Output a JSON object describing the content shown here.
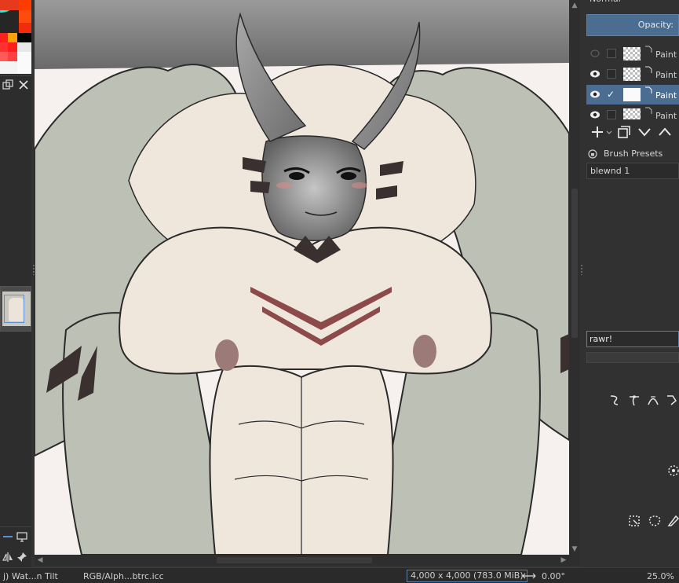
{
  "layers_panel": {
    "blend_mode": "Normal",
    "opacity_label": "Opacity:",
    "layers": [
      {
        "name": "Paint",
        "visible": false,
        "checked": false,
        "selected": false
      },
      {
        "name": "Paint",
        "visible": true,
        "checked": false,
        "selected": false
      },
      {
        "name": "Paint",
        "visible": true,
        "checked": true,
        "selected": true
      },
      {
        "name": "Paint",
        "visible": true,
        "checked": false,
        "selected": false
      }
    ]
  },
  "brush_presets": {
    "title": "Brush Presets",
    "selected_preset": "blewnd 1",
    "tag_input_value": "rawr!"
  },
  "status_bar": {
    "brush_name": "j) Wat...n Tilt",
    "color_profile": "RGB/Alph...btrc.icc",
    "image_size": "4,000 x 4,000 (783.0 MiB)",
    "rotation": "0.00°",
    "zoom": "25.0%"
  },
  "colors": {
    "accent": "#4a6d91",
    "canvas_background": "#f6f1ee",
    "skin_light": "#efe6dc",
    "skin_shadow": "#bdc0b4",
    "horns": "#8c8c8c",
    "chest_markings": "#8c4a4a",
    "nipples": "#9b7a78"
  },
  "icons": [
    "eye-icon",
    "check-icon",
    "add-icon",
    "duplicate-icon",
    "chevron-down-icon",
    "lock-icon",
    "close-icon",
    "pin-icon",
    "rotate-icon"
  ]
}
